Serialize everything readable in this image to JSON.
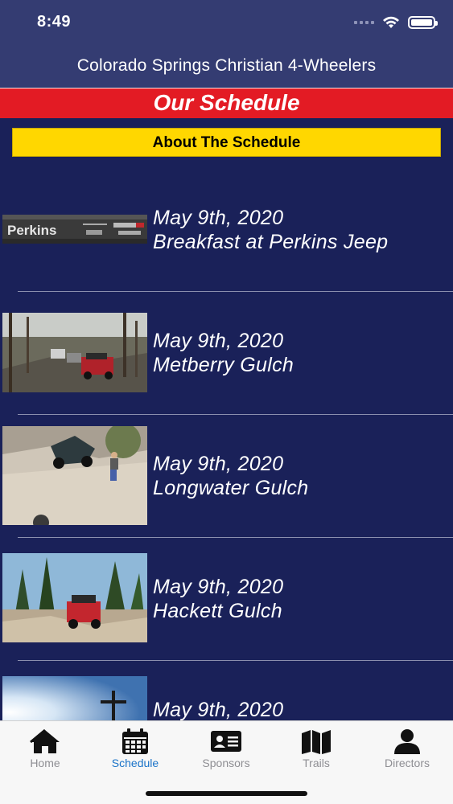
{
  "status_bar": {
    "time": "8:49"
  },
  "header": {
    "title": "Colorado Springs Christian 4-Wheelers"
  },
  "banner": {
    "title": "Our Schedule"
  },
  "about_button": {
    "label": "About The Schedule"
  },
  "colors": {
    "nav_bg": "#343c72",
    "page_bg": "#1a2159",
    "banner_red": "#e31b24",
    "button_yellow": "#ffd700",
    "tab_active": "#1a73c8",
    "tab_inactive": "#8e8e93"
  },
  "events": [
    {
      "date": "May 9th, 2020",
      "name": "Breakfast at Perkins Jeep",
      "image": "perkins-dealership-sign"
    },
    {
      "date": "May 9th, 2020",
      "name": "Metberry Gulch",
      "image": "jeep-on-forest-trail"
    },
    {
      "date": "May 9th, 2020",
      "name": "Longwater Gulch",
      "image": "jeep-on-rock-slab"
    },
    {
      "date": "May 9th, 2020",
      "name": "Hackett Gulch",
      "image": "red-jeep-in-pine-forest"
    },
    {
      "date": "May 9th, 2020",
      "name": "",
      "image": "cross-against-sky"
    }
  ],
  "perkins_logo_text": "Perkins",
  "tabs": [
    {
      "label": "Home",
      "icon": "home-icon",
      "active": false
    },
    {
      "label": "Schedule",
      "icon": "calendar-icon",
      "active": true
    },
    {
      "label": "Sponsors",
      "icon": "id-card-icon",
      "active": false
    },
    {
      "label": "Trails",
      "icon": "map-icon",
      "active": false
    },
    {
      "label": "Directors",
      "icon": "user-icon",
      "active": false
    }
  ]
}
